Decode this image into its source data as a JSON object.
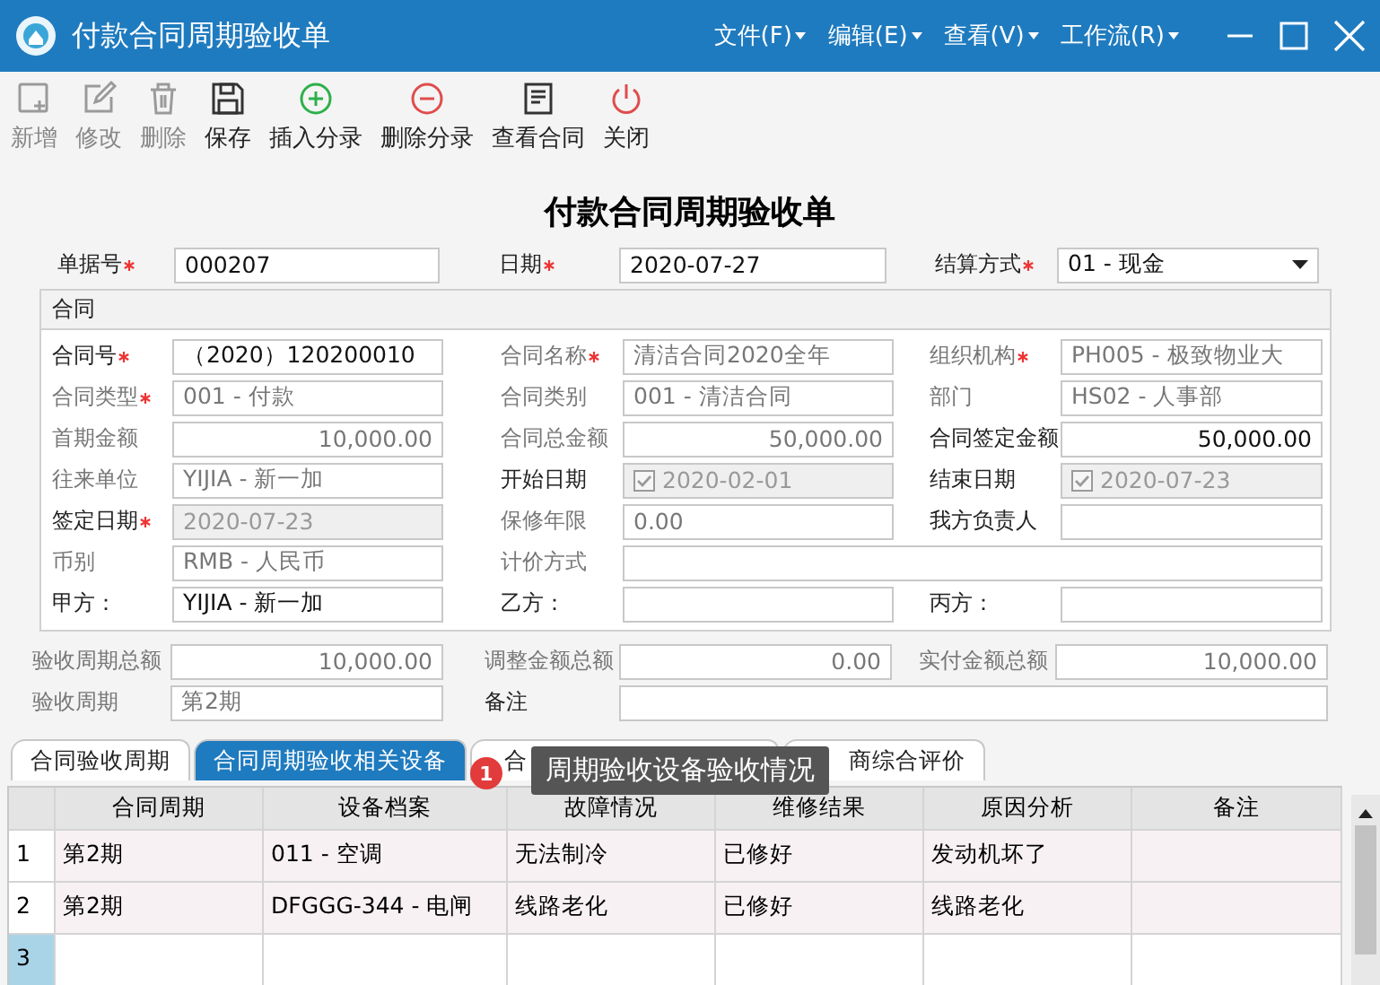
{
  "window": {
    "title": "付款合同周期验收单",
    "menus": [
      {
        "label": "文件(F)"
      },
      {
        "label": "编辑(E)"
      },
      {
        "label": "查看(V)"
      },
      {
        "label": "工作流(R)"
      }
    ]
  },
  "toolbar": [
    {
      "kind": "new",
      "label": "新增",
      "disabled": true
    },
    {
      "kind": "edit",
      "label": "修改",
      "disabled": true
    },
    {
      "kind": "delete",
      "label": "删除",
      "disabled": true
    },
    {
      "kind": "save",
      "label": "保存",
      "disabled": false
    },
    {
      "kind": "insert",
      "label": "插入分录",
      "disabled": false
    },
    {
      "kind": "remove",
      "label": "删除分录",
      "disabled": false
    },
    {
      "kind": "view",
      "label": "查看合同",
      "disabled": false
    },
    {
      "kind": "close",
      "label": "关闭",
      "disabled": false
    }
  ],
  "form_title": "付款合同周期验收单",
  "header_fields": [
    {
      "kind": "text",
      "label": "单据号",
      "value": "000207",
      "required": true,
      "muted": false,
      "disabled": false
    },
    {
      "kind": "text",
      "label": "日期",
      "value": "2020-07-27",
      "required": true,
      "muted": false,
      "disabled": false
    },
    {
      "kind": "select",
      "label": "结算方式",
      "value": "01 - 现金",
      "required": true,
      "muted": false,
      "disabled": false
    }
  ],
  "contract_group": {
    "title": "合同",
    "rows": [
      [
        {
          "kind": "text",
          "label": "合同号",
          "value": "（2020）120200010",
          "required": true,
          "muted": false,
          "disabled": false
        },
        {
          "kind": "text",
          "label": "合同名称",
          "value": "清洁合同2020全年",
          "required": true,
          "muted": true,
          "disabled": false
        },
        {
          "kind": "text",
          "label": "组织机构",
          "value": "PH005 - 极致物业大",
          "required": true,
          "muted": true,
          "disabled": false
        }
      ],
      [
        {
          "kind": "text",
          "label": "合同类型",
          "value": "001 - 付款",
          "required": true,
          "muted": true,
          "disabled": false
        },
        {
          "kind": "text",
          "label": "合同类别",
          "value": "001 - 清洁合同",
          "muted": true,
          "disabled": false
        },
        {
          "kind": "text",
          "label": "部门",
          "value": "HS02 - 人事部",
          "muted": true,
          "disabled": false
        }
      ],
      [
        {
          "kind": "amount",
          "label": "首期金额",
          "value": "10,000.00",
          "muted": true,
          "disabled": false
        },
        {
          "kind": "amount",
          "label": "合同总金额",
          "value": "50,000.00",
          "muted": true,
          "disabled": false
        },
        {
          "kind": "amount",
          "label": "合同签定金额",
          "value": "50,000.00",
          "muted": false,
          "disabled": false
        }
      ],
      [
        {
          "kind": "text",
          "label": "往来单位",
          "value": "YIJIA - 新一加",
          "muted": true,
          "disabled": false
        },
        {
          "kind": "date_check",
          "label": "开始日期",
          "value": "2020-02-01",
          "checked": true,
          "muted": false,
          "disabled": true
        },
        {
          "kind": "date_check",
          "label": "结束日期",
          "value": "2020-07-23",
          "checked": true,
          "muted": false,
          "disabled": true
        }
      ],
      [
        {
          "kind": "text",
          "label": "签定日期",
          "value": "2020-07-23",
          "required": true,
          "muted": false,
          "disabled": true
        },
        {
          "kind": "text",
          "label": "保修年限",
          "value": "0.00",
          "muted": true,
          "disabled": false
        },
        {
          "kind": "text",
          "label": "我方负责人",
          "muted": false,
          "disabled": false
        }
      ],
      [
        {
          "kind": "text",
          "label": "币别",
          "value": "RMB - 人民币",
          "muted": true,
          "disabled": false
        },
        {
          "kind": "text",
          "label": "计价方式",
          "muted": true,
          "disabled": false
        }
      ],
      [
        {
          "kind": "text",
          "label": "甲方：",
          "value": "YIJIA - 新一加",
          "muted": false,
          "disabled": false
        },
        {
          "kind": "text",
          "label": "乙方：",
          "muted": false,
          "disabled": false
        },
        {
          "kind": "text",
          "label": "丙方：",
          "muted": false,
          "disabled": false
        }
      ]
    ]
  },
  "summary_rows": [
    [
      {
        "kind": "amount",
        "label": "验收周期总额",
        "value": "10,000.00",
        "muted": true,
        "disabled": false
      },
      {
        "kind": "amount",
        "label": "调整金额总额",
        "value": "0.00",
        "muted": true,
        "disabled": false
      },
      {
        "kind": "amount",
        "label": "实付金额总额",
        "value": "10,000.00",
        "muted": true,
        "disabled": false
      }
    ],
    [
      {
        "kind": "text",
        "label": "验收周期",
        "value": "第2期",
        "muted": true,
        "disabled": false
      },
      {
        "kind": "text",
        "label": "备注",
        "muted": false,
        "disabled": false
      }
    ]
  ],
  "tabs": [
    {
      "label": "合同验收周期",
      "selected": false
    },
    {
      "label": "合同周期验收相关设备",
      "selected": true
    },
    {
      "label": "合",
      "selected": false
    },
    {
      "label": "商综合评价",
      "selected": false
    }
  ],
  "tooltip": {
    "badge": "1",
    "text": "周期验收设备验收情况"
  },
  "table": {
    "columns": [
      "合同周期",
      "设备档案",
      "故障情况",
      "维修结果",
      "原因分析",
      "备注"
    ],
    "rows": [
      {
        "number": "1",
        "current": false,
        "cells": [
          "第2期",
          "011 - 空调",
          "无法制冷",
          "已修好",
          "发动机坏了",
          ""
        ]
      },
      {
        "number": "2",
        "current": false,
        "cells": [
          "第2期",
          "DFGGG-344 - 电闸",
          "线路老化",
          "已修好",
          "线路老化",
          ""
        ]
      },
      {
        "number": "3",
        "current": true,
        "cells": [
          "",
          "",
          "",
          "",
          "",
          ""
        ]
      }
    ]
  }
}
